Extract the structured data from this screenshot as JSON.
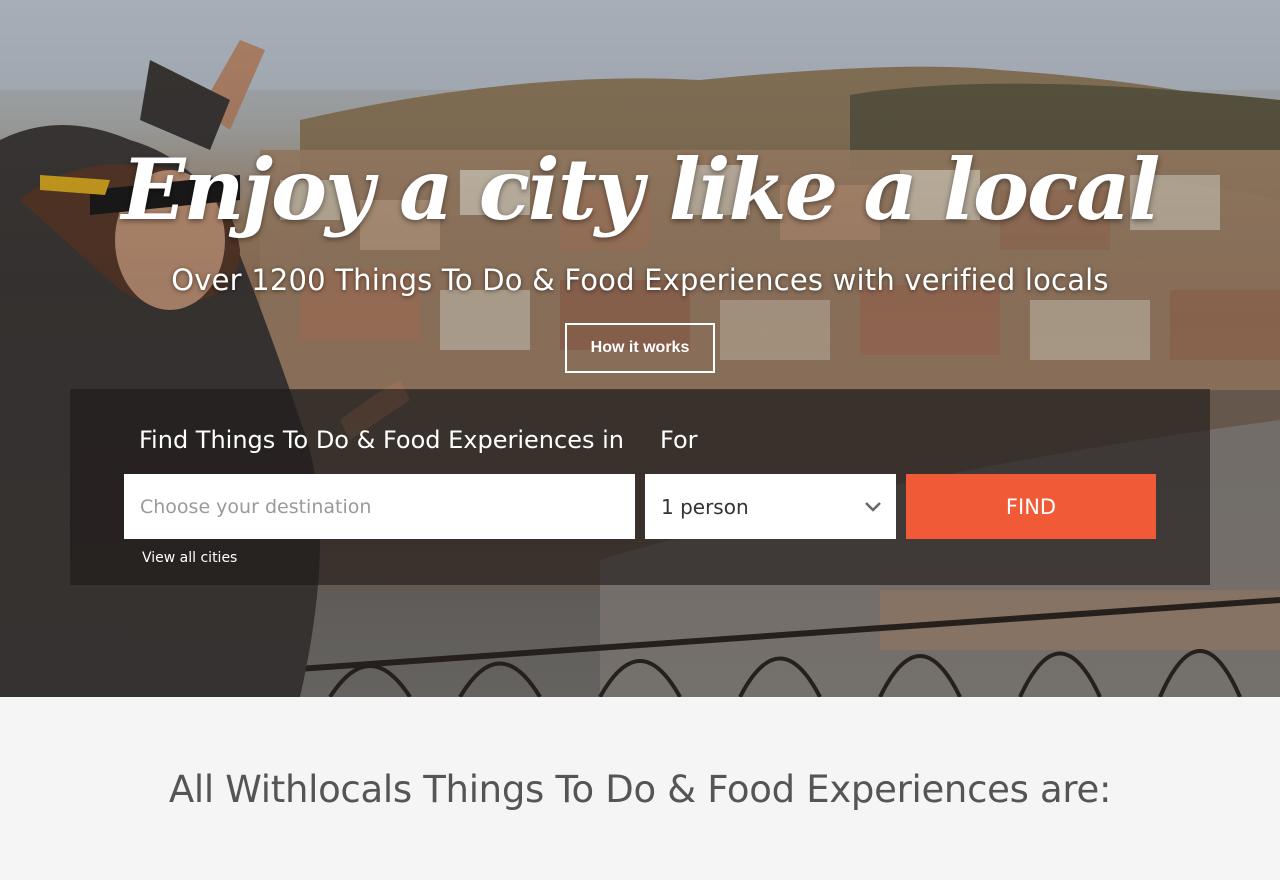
{
  "hero": {
    "title": "Enjoy a city like a local",
    "subtitle": "Over 1200 Things To Do & Food Experiences with verified locals",
    "how_it_works_label": "How it works",
    "background_image": "person-pointing-at-city-view"
  },
  "search": {
    "find_label": "Find Things To Do & Food Experiences in",
    "for_label": "For",
    "destination_placeholder": "Choose your destination",
    "destination_value": "",
    "persons_selected": "1 person",
    "persons_icon": "chevron-down-icon",
    "find_button_label": "FIND",
    "view_all_label": "View all cities",
    "accent_color": "#f15a37"
  },
  "features": {
    "heading": "All Withlocals Things To Do & Food Experiences are:"
  }
}
